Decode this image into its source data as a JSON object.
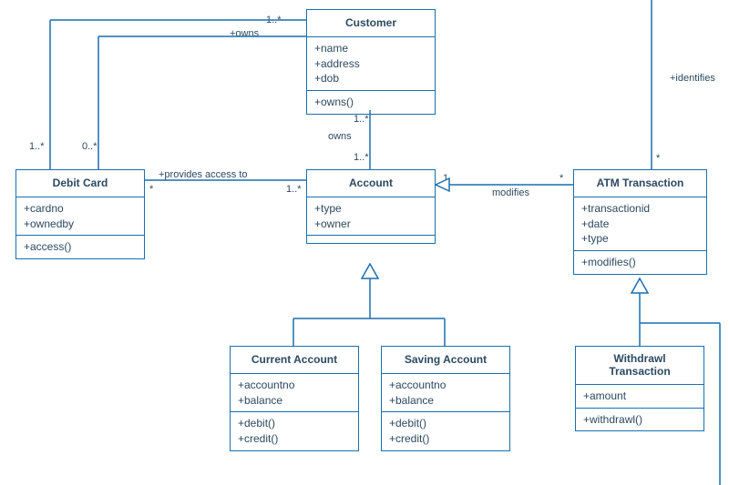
{
  "classes": {
    "customer": {
      "name": "Customer",
      "attrs": [
        "+name",
        "+address",
        "+dob"
      ],
      "methods": [
        "+owns()"
      ]
    },
    "debitCard": {
      "name": "Debit Card",
      "attrs": [
        "+cardno",
        "+ownedby"
      ],
      "methods": [
        "+access()"
      ]
    },
    "account": {
      "name": "Account",
      "attrs": [
        "+type",
        "+owner"
      ],
      "methods": [
        ""
      ]
    },
    "atm": {
      "name": "ATM Transaction",
      "attrs": [
        "+transactionid",
        "+date",
        "+type"
      ],
      "methods": [
        "+modifies()"
      ]
    },
    "current": {
      "name": "Current Account",
      "attrs": [
        "+accountno",
        "+balance"
      ],
      "methods": [
        "+debit()",
        "+credit()"
      ]
    },
    "saving": {
      "name": "Saving Account",
      "attrs": [
        "+accountno",
        "+balance"
      ],
      "methods": [
        "+debit()",
        "+credit()"
      ]
    },
    "withdrawl": {
      "name": "Withdrawl Transaction",
      "attrs": [
        "+amount"
      ],
      "methods": [
        "+withdrawl()"
      ]
    }
  },
  "labels": {
    "ownsTop": "+owns",
    "ownsMid": "owns",
    "mTop": "1..*",
    "m0s": "0..*",
    "m1s": "1..*",
    "providesAccess": "+provides access to",
    "m1sL": "1..*",
    "mStarL": "*",
    "m1sUnderCust": "1..*",
    "m1sAboveAcct": "1..*",
    "modifies": "modifies",
    "m1": "1",
    "mStarR": "*",
    "identifies": "+identifies",
    "mStarIdent": "*"
  }
}
